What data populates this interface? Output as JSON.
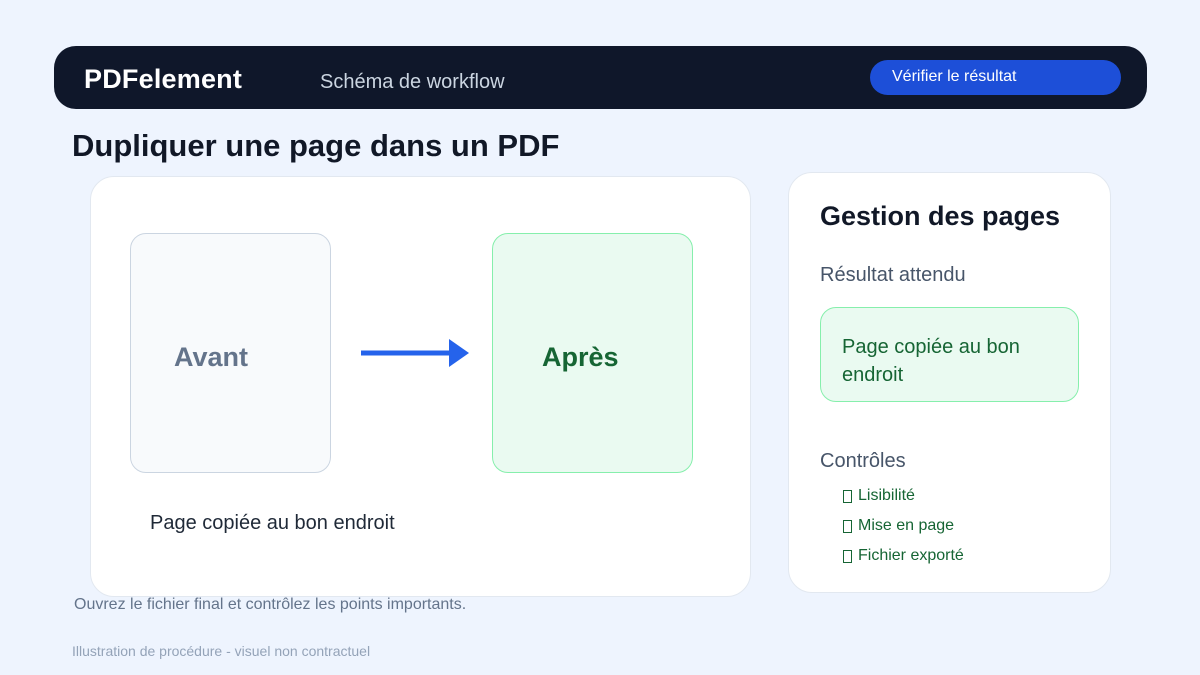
{
  "header": {
    "brand": "PDFelement",
    "subtitle": "Schéma de workflow",
    "verify_button": "Vérifier le résultat"
  },
  "page_title": "Dupliquer une page dans un PDF",
  "workflow": {
    "before_label": "Avant",
    "after_label": "Après",
    "arrow_icon": "arrow-right-icon",
    "caption": "Page copiée au bon endroit"
  },
  "side_panel": {
    "title": "Gestion des pages",
    "result_label": "Résultat attendu",
    "result_value": "Page copiée au bon endroit",
    "checks_label": "Contrôles",
    "checks": [
      "Lisibilité",
      "Mise en page",
      "Fichier exporté"
    ]
  },
  "instruction": "Ouvrez le fichier final et contrôlez les points importants.",
  "footer_note": "Illustration de procédure - visuel non contractuel",
  "colors": {
    "background": "#eef4fe",
    "header_bg": "#0f172a",
    "accent_blue": "#1d4fd8",
    "success_green": "#166534",
    "success_bg": "#eafaf1"
  }
}
